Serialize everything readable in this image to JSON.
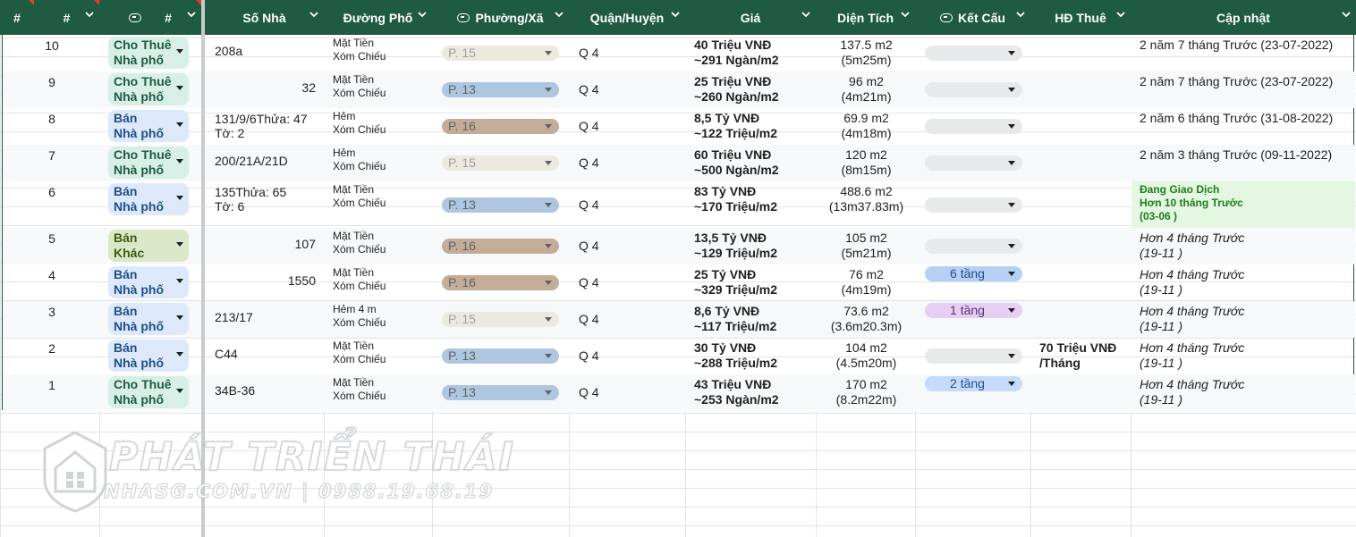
{
  "header": {
    "col_row": "#",
    "col_id": "#",
    "col_type": "#",
    "col_number": "Số Nhà",
    "col_street": "Đường Phố",
    "col_ward": "Phường/Xã",
    "col_district": "Quận/Huyện",
    "col_price": "Giá",
    "col_area": "Diện Tích",
    "col_structure": "Kết Cấu",
    "col_lease": "HĐ Thuê",
    "col_updated": "Cập nhật"
  },
  "rows": [
    {
      "id": "10",
      "type1": "Cho Thuê",
      "type2": "Nhà phố",
      "type_kind": "thue",
      "addr1": "208a",
      "addr2": "",
      "addr_align": "left",
      "street1": "Mặt Tiền",
      "street2": "Xóm Chiếu",
      "ward": "P. 15",
      "ward_kind": "p15",
      "district": "Q 4",
      "price1": "40 Triệu VNĐ",
      "price2": "~291 Ngàn/m2",
      "area1": "137.5 m2",
      "area2": "(5m25m)",
      "structure": "",
      "lease1": "",
      "lease2": "",
      "upd1": "2 năm 7 tháng Trước (23-07-2022)",
      "upd2": "",
      "upd3": "",
      "upd_kind": "normal"
    },
    {
      "id": "9",
      "type1": "Cho Thuê",
      "type2": "Nhà phố",
      "type_kind": "thue",
      "addr1": "32",
      "addr2": "",
      "addr_align": "right",
      "street1": "Mặt Tiền",
      "street2": "Xóm Chiếu",
      "ward": "P. 13",
      "ward_kind": "p13",
      "district": "Q 4",
      "price1": "25 Triệu VNĐ",
      "price2": "~260 Ngàn/m2",
      "area1": "96 m2",
      "area2": "(4m21m)",
      "structure": "",
      "lease1": "",
      "lease2": "",
      "upd1": "2 năm 7 tháng Trước (23-07-2022)",
      "upd2": "",
      "upd3": "",
      "upd_kind": "normal"
    },
    {
      "id": "8",
      "type1": "Bán",
      "type2": "Nhà phố",
      "type_kind": "ban",
      "addr1": "131/9/6Thửa: 47",
      "addr2": "Tờ: 2",
      "addr_align": "left",
      "street1": "Hẻm",
      "street2": "Xóm Chiếu",
      "ward": "P. 16",
      "ward_kind": "p16",
      "district": "Q 4",
      "price1": "8,5 Tỷ VNĐ",
      "price2": "~122 Triệu/m2",
      "area1": "69.9 m2",
      "area2": "(4m18m)",
      "structure": "",
      "lease1": "",
      "lease2": "",
      "upd1": "2 năm 6 tháng Trước (31-08-2022)",
      "upd2": "",
      "upd3": "",
      "upd_kind": "normal"
    },
    {
      "id": "7",
      "type1": "Cho Thuê",
      "type2": "Nhà phố",
      "type_kind": "thue",
      "addr1": "200/21A/21D",
      "addr2": "",
      "addr_align": "left",
      "street1": "Hẻm",
      "street2": "Xóm Chiếu",
      "ward": "P. 15",
      "ward_kind": "p15",
      "district": "Q 4",
      "price1": "60 Triệu VNĐ",
      "price2": "~500 Ngàn/m2",
      "area1": "120 m2",
      "area2": "(8m15m)",
      "structure": "",
      "lease1": "",
      "lease2": "",
      "upd1": "2 năm 3 tháng Trước (09-11-2022)",
      "upd2": "",
      "upd3": "",
      "upd_kind": "normal"
    },
    {
      "id": "6",
      "type1": "Bán",
      "type2": "Nhà phố",
      "type_kind": "ban",
      "addr1": "135Thửa: 65",
      "addr2": "Tờ: 6",
      "addr_align": "left",
      "street1": "Mặt Tiền",
      "street2": "Xóm Chiếu",
      "ward": "P. 13",
      "ward_kind": "p13",
      "district": "Q 4",
      "price1": "83 Tỷ VNĐ",
      "price2": "~170 Triệu/m2",
      "area1": "488.6 m2",
      "area2": "(13m37.83m)",
      "structure": "",
      "lease1": "",
      "lease2": "",
      "upd1": "Đang Giao Dịch",
      "upd2": "Hơn 10 tháng Trước",
      "upd3": "(03-06 )",
      "upd_kind": "deal"
    },
    {
      "id": "5",
      "type1": "Bán",
      "type2": "Khác",
      "type_kind": "khac",
      "addr1": "107",
      "addr2": "",
      "addr_align": "right",
      "street1": "Mặt Tiền",
      "street2": "Xóm Chiếu",
      "ward": "P. 16",
      "ward_kind": "p16",
      "district": "Q 4",
      "price1": "13,5 Tỷ VNĐ",
      "price2": "~129 Triệu/m2",
      "area1": "105 m2",
      "area2": "(5m21m)",
      "structure": "",
      "lease1": "",
      "lease2": "",
      "upd1": "Hơn 4 tháng Trước",
      "upd2": "(19-11 )",
      "upd3": "",
      "upd_kind": "italic"
    },
    {
      "id": "4",
      "type1": "Bán",
      "type2": "Nhà phố",
      "type_kind": "ban",
      "addr1": "1550",
      "addr2": "",
      "addr_align": "right",
      "street1": "Mặt Tiền",
      "street2": "Xóm Chiếu",
      "ward": "P. 16",
      "ward_kind": "p16",
      "district": "Q 4",
      "price1": "25 Tỷ VNĐ",
      "price2": "~329 Triệu/m2",
      "area1": "76 m2",
      "area2": "(4m19m)",
      "structure": "6 tầng",
      "structure_kind": "s6",
      "lease1": "",
      "lease2": "",
      "upd1": "Hơn 4 tháng Trước",
      "upd2": "(19-11 )",
      "upd3": "",
      "upd_kind": "italic"
    },
    {
      "id": "3",
      "type1": "Bán",
      "type2": "Nhà phố",
      "type_kind": "ban",
      "addr1": "213/17",
      "addr2": "",
      "addr_align": "left",
      "street1": "Hẻm 4 m",
      "street2": "Xóm Chiếu",
      "ward": "P. 15",
      "ward_kind": "p15",
      "district": "Q 4",
      "price1": "8,6 Tỷ VNĐ",
      "price2": "~117 Triệu/m2",
      "area1": "73.6 m2",
      "area2": "(3.6m20.3m)",
      "structure": "1 tầng",
      "structure_kind": "s1",
      "lease1": "",
      "lease2": "",
      "upd1": "Hơn 4 tháng Trước",
      "upd2": "(19-11 )",
      "upd3": "",
      "upd_kind": "italic"
    },
    {
      "id": "2",
      "type1": "Bán",
      "type2": "Nhà phố",
      "type_kind": "ban",
      "addr1": "C44",
      "addr2": "",
      "addr_align": "left",
      "street1": "Mặt Tiền",
      "street2": "Xóm Chiếu",
      "ward": "P. 13",
      "ward_kind": "p13",
      "district": "Q 4",
      "price1": "30 Tỷ VNĐ",
      "price2": "~288 Triệu/m2",
      "area1": "104 m2",
      "area2": "(4.5m20m)",
      "structure": "",
      "lease1": "70 Triệu VNĐ",
      "lease2": "/Tháng",
      "upd1": "Hơn 4 tháng Trước",
      "upd2": "(19-11 )",
      "upd3": "",
      "upd_kind": "italic"
    },
    {
      "id": "1",
      "type1": "Cho Thuê",
      "type2": "Nhà phố",
      "type_kind": "thue",
      "addr1": "34B-36",
      "addr2": "",
      "addr_align": "left",
      "street1": "Mặt Tiền",
      "street2": "Xóm Chiếu",
      "ward": "P. 13",
      "ward_kind": "p13",
      "district": "Q 4",
      "price1": "43 Triệu VNĐ",
      "price2": "~253 Ngàn/m2",
      "area1": "170 m2",
      "area2": "(8.2m22m)",
      "structure": "2 tầng",
      "structure_kind": "s2",
      "lease1": "",
      "lease2": "",
      "upd1": "Hơn 4 tháng Trước",
      "upd2": "(19-11 )",
      "upd3": "",
      "upd_kind": "italic"
    }
  ],
  "watermark": {
    "brand": "PHÁT TRIỂN THÁI",
    "sub": "NHASG.COM.VN | 0988.19.68.19"
  },
  "colors": {
    "header_bg": "#1e5b40",
    "accent_green": "#1f7a1f"
  }
}
